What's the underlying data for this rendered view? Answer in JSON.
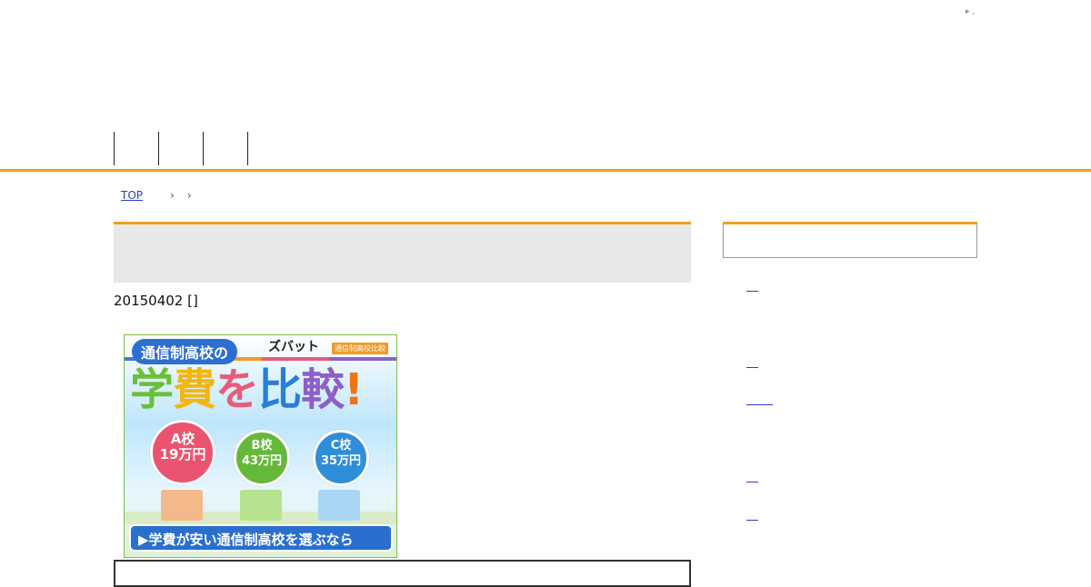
{
  "header": {
    "top_marker": "▸ ,"
  },
  "nav": {
    "items": [
      "",
      "",
      ""
    ]
  },
  "breadcrumb": {
    "home": "TOP",
    "sep1": "›",
    "sep2": "›"
  },
  "article": {
    "title": "",
    "date_text": "20150402 []"
  },
  "banner": {
    "pill_text": "通信制高校の",
    "brand": "ズバット",
    "brand_tag": "通信制高校比較",
    "headline": [
      "学",
      "費",
      "を",
      "比",
      "較",
      "!"
    ],
    "bubbles": [
      {
        "school": "A校",
        "amount": "19万円"
      },
      {
        "school": "B校",
        "amount": "43万円"
      },
      {
        "school": "C校",
        "amount": "35万円"
      }
    ],
    "cta": "▶学費が安い通信制高校を選ぶなら"
  },
  "sidebar": {
    "header": "",
    "links": [
      "",
      "",
      "",
      "",
      ""
    ]
  }
}
